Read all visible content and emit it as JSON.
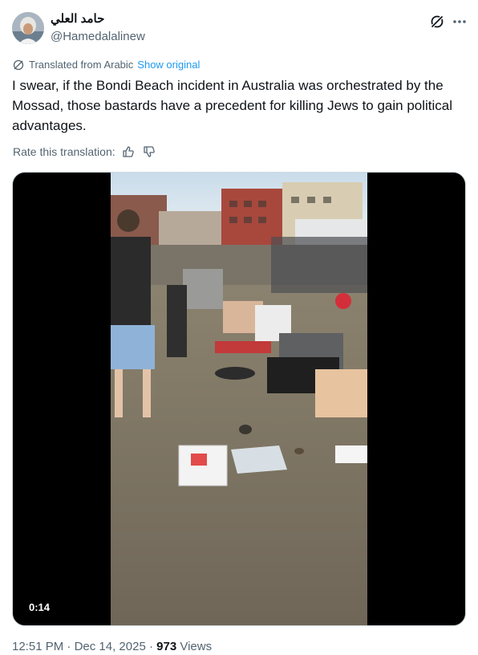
{
  "author": {
    "display_name": "حامد العلي",
    "handle": "@Hamedalalinew"
  },
  "translation": {
    "label": "Translated from Arabic",
    "show_original": "Show original",
    "rate_label": "Rate this translation:"
  },
  "tweet": {
    "text": "I swear, if the Bondi Beach incident in Australia was orchestrated by the Mossad, those bastards have a precedent for killing Jews to gain political advantages."
  },
  "media": {
    "duration": "0:14"
  },
  "meta": {
    "time": "12:51 PM",
    "separator": "·",
    "date": "Dec 14, 2025",
    "separator2": "·",
    "views_count": "973",
    "views_label": "Views"
  },
  "icons": {
    "grok": "grok-icon",
    "more": "more-icon",
    "globe": "globe-icon",
    "thumbs_up": "thumbs-up-icon",
    "thumbs_down": "thumbs-down-icon"
  },
  "colors": {
    "link": "#1d9bf0",
    "secondary_text": "#536471",
    "primary_text": "#0f1419"
  }
}
